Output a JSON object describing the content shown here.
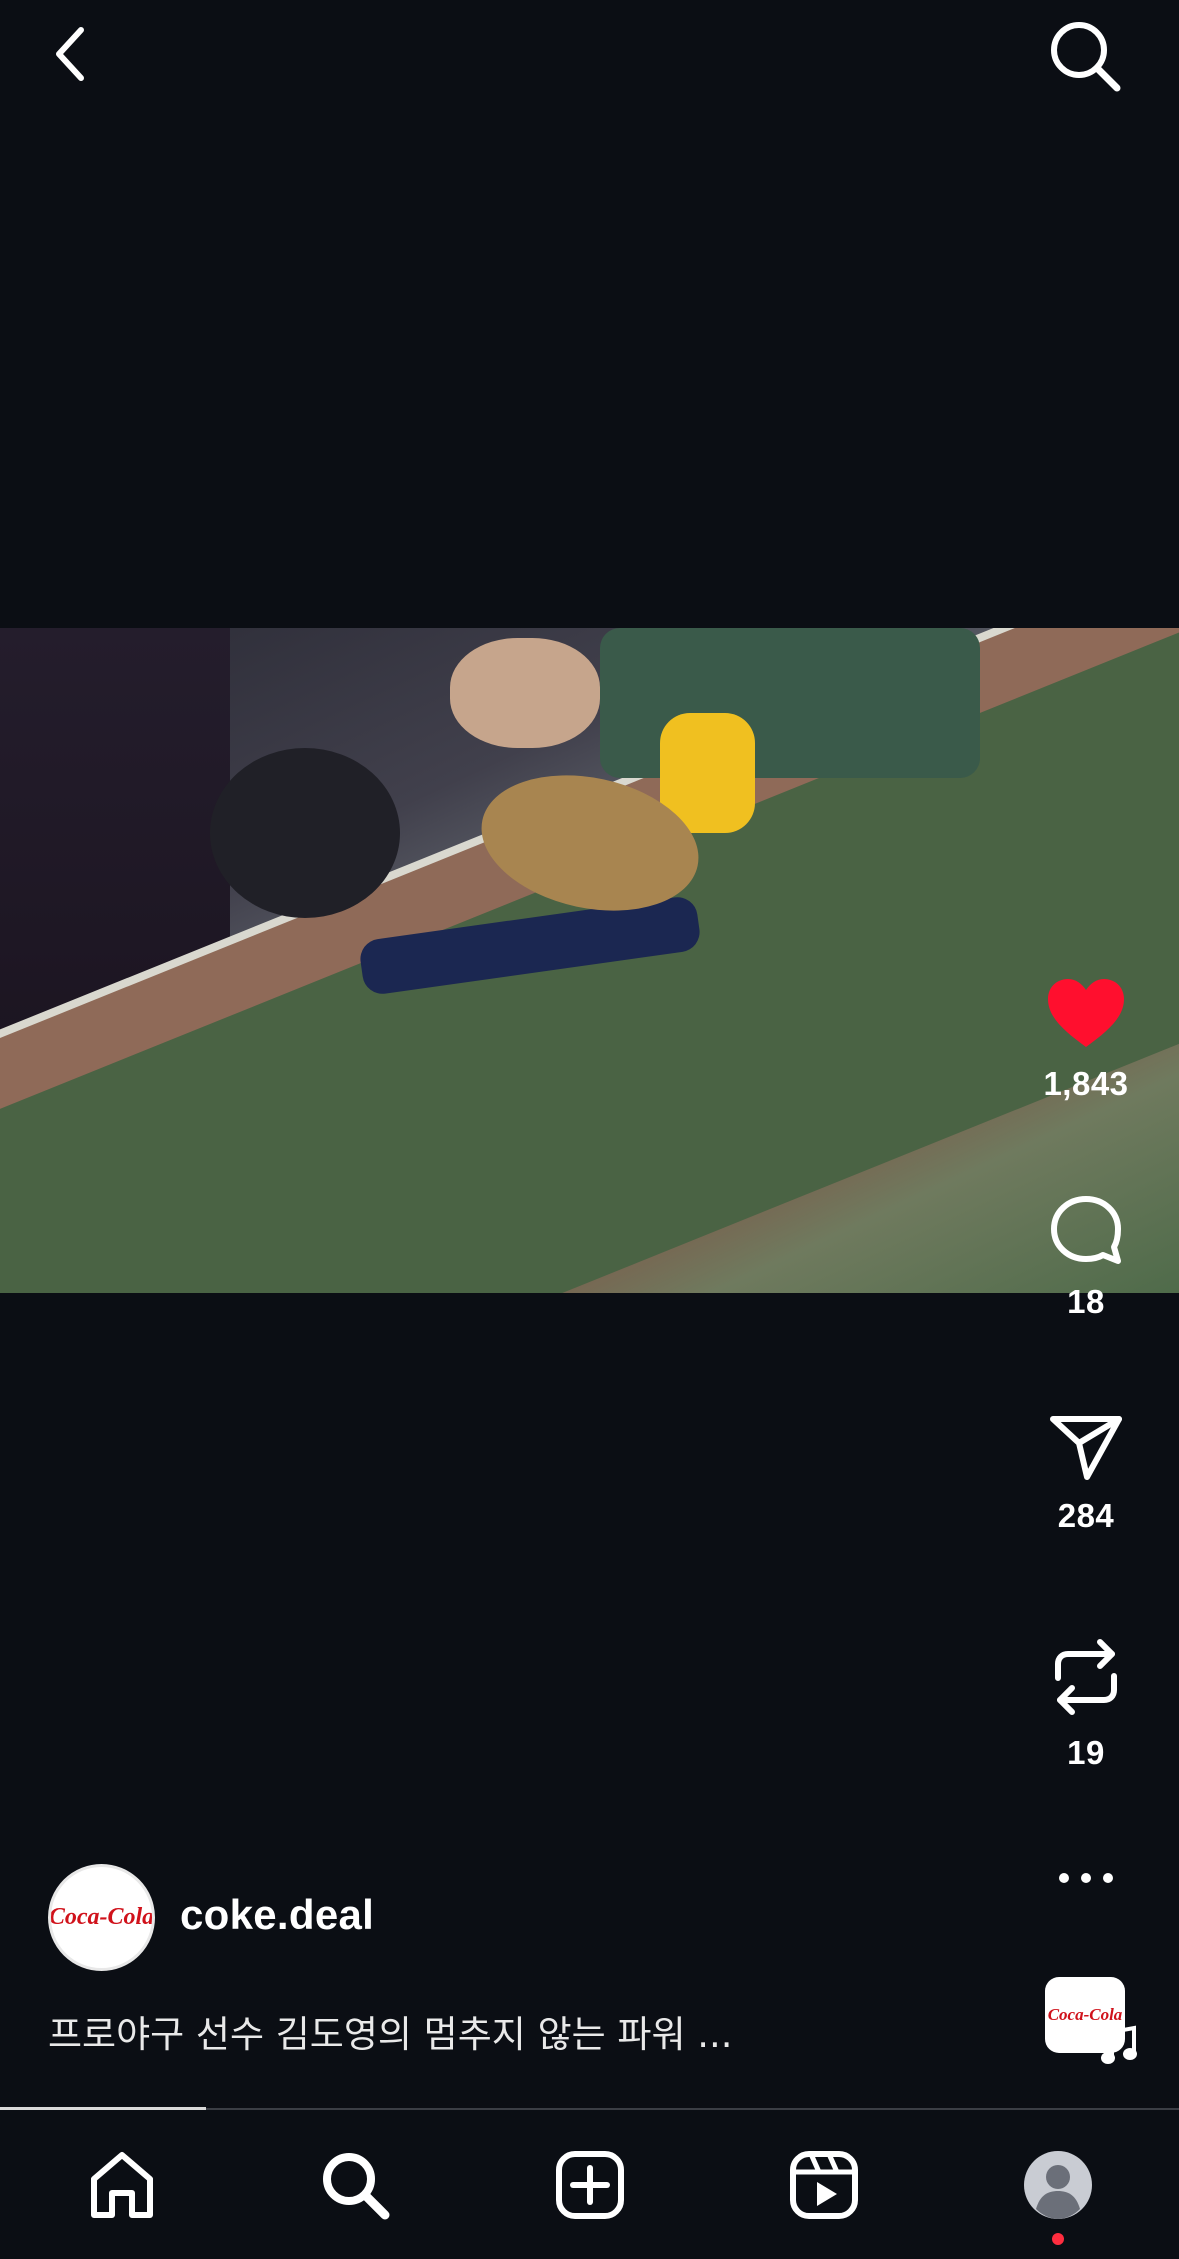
{
  "topbar": {
    "back_icon": "chevron-left-icon",
    "search_icon": "search-icon"
  },
  "actions": {
    "like": {
      "icon": "heart-icon",
      "count": "1,843",
      "color": "#ff0f2e"
    },
    "comment": {
      "icon": "comment-icon",
      "count": "18"
    },
    "share": {
      "icon": "send-icon",
      "count": "284"
    },
    "repost": {
      "icon": "repost-icon",
      "count": "19"
    },
    "more": {
      "icon": "more-icon"
    }
  },
  "post": {
    "username": "coke.deal",
    "avatar_text": "Coca-Cola",
    "caption": "프로야구 선수 김도영의 멈추지 않는 파워 ..."
  },
  "audio": {
    "thumb_text": "Coca-Cola",
    "music_icon": "music-note-icon"
  },
  "progress": {
    "fraction": 0.175
  },
  "nav": {
    "items": [
      {
        "name": "home",
        "icon": "home-icon"
      },
      {
        "name": "search",
        "icon": "search-icon"
      },
      {
        "name": "create",
        "icon": "plus-square-icon"
      },
      {
        "name": "reels",
        "icon": "reels-icon"
      },
      {
        "name": "profile",
        "icon": "profile-avatar-icon"
      }
    ],
    "notification_color": "#ff2d3f"
  }
}
